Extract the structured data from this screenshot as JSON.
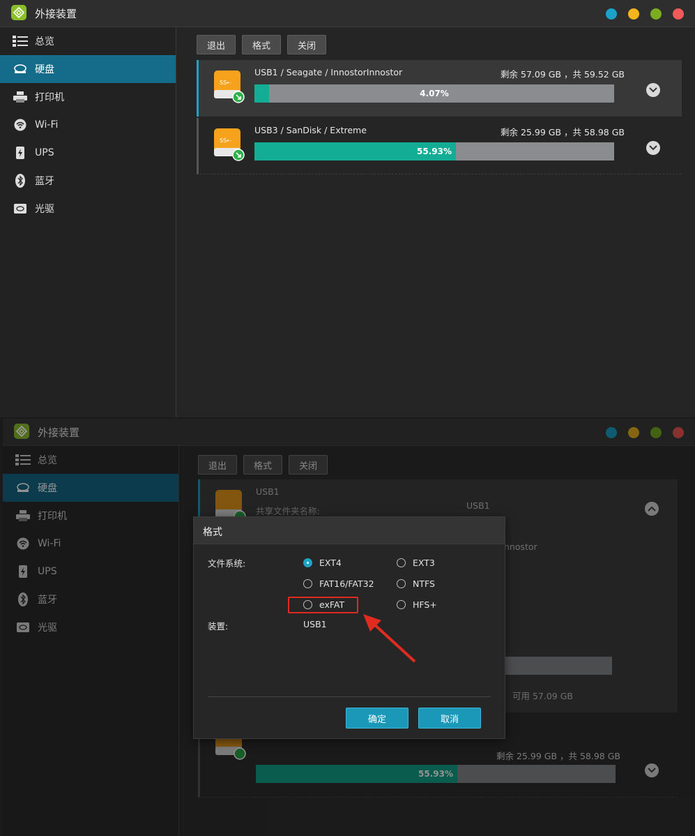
{
  "window": {
    "title": "外接装置",
    "colors": {
      "blue": "#1ca1c8",
      "yellow": "#f2b51d",
      "green": "#7cad20",
      "red": "#f25a5a"
    }
  },
  "sidebar": {
    "items": [
      {
        "label": "总览",
        "icon": "overview-icon"
      },
      {
        "label": "硬盘",
        "icon": "hard-disk-icon"
      },
      {
        "label": "打印机",
        "icon": "printer-icon"
      },
      {
        "label": "Wi-Fi",
        "icon": "wifi-icon"
      },
      {
        "label": "UPS",
        "icon": "ups-icon"
      },
      {
        "label": "蓝牙",
        "icon": "bluetooth-icon"
      },
      {
        "label": "光驱",
        "icon": "optical-drive-icon"
      }
    ]
  },
  "toolbar": {
    "eject": "退出",
    "format": "格式",
    "close": "关闭"
  },
  "drives": [
    {
      "name": "USB1 / Seagate / InnostorInnostor",
      "size": "剩余 57.09 GB ，共 59.52 GB",
      "percent_label": "4.07%",
      "usage": 0.0407
    },
    {
      "name": "USB3 / SanDisk / Extreme",
      "size": "剩余 25.99 GB ，共 58.98 GB",
      "percent_label": "55.93%",
      "usage": 0.5593
    }
  ],
  "expanded": {
    "name": "USB1",
    "share_label": "共享文件夹名称:",
    "share_value": "USB1",
    "model_fragment": "nnostor",
    "available": "可用 57.09 GB"
  },
  "dialog": {
    "title": "格式",
    "fs_label": "文件系统:",
    "options": [
      "EXT4",
      "EXT3",
      "FAT16/FAT32",
      "NTFS",
      "exFAT",
      "HFS+"
    ],
    "selected": "EXT4",
    "device_label": "装置:",
    "device_value": "USB1",
    "ok": "确定",
    "cancel": "取消"
  }
}
